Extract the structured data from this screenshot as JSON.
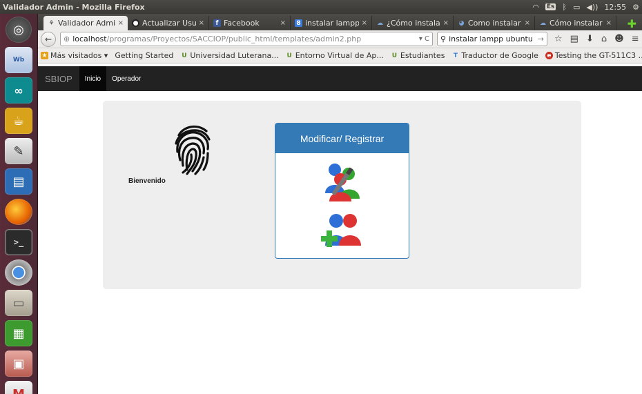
{
  "panel": {
    "window_title": "Validador Admin - Mozilla Firefox",
    "time": "12:55",
    "keyboard_layout": "Es",
    "volume_glyph": "◀))"
  },
  "launcher": [
    {
      "name": "dash-home",
      "glyph": "◎",
      "cls": "dash"
    },
    {
      "name": "workbench",
      "glyph": "Wb",
      "cls": "wb"
    },
    {
      "name": "arduino",
      "glyph": "∞",
      "cls": "ard"
    },
    {
      "name": "teapot",
      "glyph": "☕",
      "cls": "teapot"
    },
    {
      "name": "text-editor",
      "glyph": "✎",
      "cls": "editor"
    },
    {
      "name": "writer",
      "glyph": "▤",
      "cls": "writer"
    },
    {
      "name": "firefox",
      "glyph": "",
      "cls": "firefox"
    },
    {
      "name": "terminal",
      "glyph": ">_",
      "cls": "term"
    },
    {
      "name": "chromium",
      "glyph": "",
      "cls": "chrome"
    },
    {
      "name": "file-manager",
      "glyph": "▭",
      "cls": "files"
    },
    {
      "name": "calc",
      "glyph": "▦",
      "cls": "calc"
    },
    {
      "name": "photos",
      "glyph": "▣",
      "cls": "photo"
    },
    {
      "name": "gmail",
      "glyph": "M",
      "cls": "gmail"
    }
  ],
  "tabs": [
    {
      "label": "Validador Admin",
      "fav": "⚘",
      "fav_cls": "fp",
      "active": true
    },
    {
      "label": "Actualizar Usu...",
      "fav": "●",
      "fav_cls": "dark",
      "active": false
    },
    {
      "label": "Facebook",
      "fav": "f",
      "fav_cls": "fb",
      "active": false
    },
    {
      "label": "instalar lampp ...",
      "fav": "8",
      "fav_cls": "g",
      "active": false
    },
    {
      "label": "¿Cómo instalar ...",
      "fav": "☁",
      "fav_cls": "cloud",
      "active": false
    },
    {
      "label": "Como instalar ...",
      "fav": "◕",
      "fav_cls": "ub",
      "active": false
    },
    {
      "label": "Cómo instalar ...",
      "fav": "☁",
      "fav_cls": "cloud",
      "active": false
    }
  ],
  "tab_close": "×",
  "new_tab": "✚",
  "navbar": {
    "back": "←",
    "url_host": "localhost",
    "url_path": "/programas/Proyectos/SACCIOP/public_html/templates/admin2.php",
    "url_controls": "▾ C",
    "search_value": "instalar lampp ubuntu",
    "search_go": "→",
    "icons": [
      "☆",
      "▤",
      "⬇",
      "⌂",
      "☻",
      "≡"
    ]
  },
  "bookmarks": [
    {
      "label": "Más visitados ▾",
      "ico": "★",
      "cls": "star"
    },
    {
      "label": "Getting Started",
      "ico": "",
      "cls": "page"
    },
    {
      "label": "Universidad Luterana...",
      "ico": "U",
      "cls": "ul"
    },
    {
      "label": "Entorno Virtual de Ap...",
      "ico": "U",
      "cls": "ul"
    },
    {
      "label": "Estudiantes",
      "ico": "U",
      "cls": "ul"
    },
    {
      "label": "Traductor de Google",
      "ico": "T",
      "cls": "tr"
    },
    {
      "label": "Testing the GT-511C3 ...",
      "ico": "e",
      "cls": "red"
    }
  ],
  "app": {
    "brand": "SBIOP",
    "nav": [
      {
        "label": "Inicio",
        "active": true
      },
      {
        "label": "Operador",
        "active": false
      }
    ],
    "welcome": "Bienvenido",
    "panel_title": "Modificar/ Registrar",
    "colors": {
      "navbar": "#222222",
      "panel": "#337ab7",
      "jumbotron": "#eeeeee"
    }
  }
}
